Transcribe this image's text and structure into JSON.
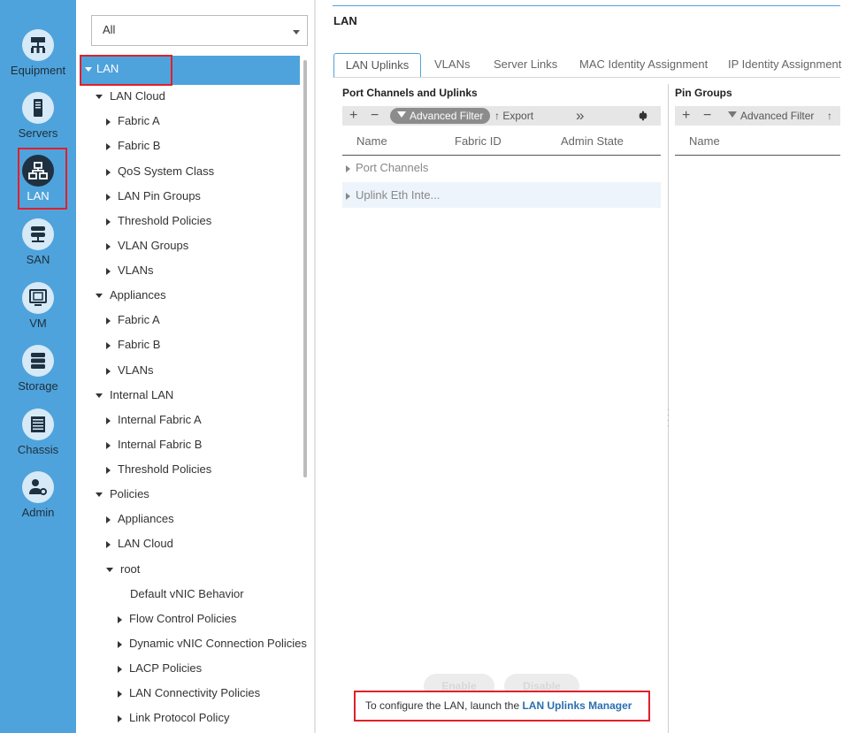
{
  "leftnav": {
    "items": [
      {
        "label": "Equipment",
        "icon": "equipment-icon"
      },
      {
        "label": "Servers",
        "icon": "servers-icon"
      },
      {
        "label": "LAN",
        "icon": "lan-icon"
      },
      {
        "label": "SAN",
        "icon": "san-icon"
      },
      {
        "label": "VM",
        "icon": "vm-icon"
      },
      {
        "label": "Storage",
        "icon": "storage-icon"
      },
      {
        "label": "Chassis",
        "icon": "chassis-icon"
      },
      {
        "label": "Admin",
        "icon": "admin-icon"
      }
    ],
    "active": "LAN",
    "accent": "#4fa3dc"
  },
  "tree": {
    "filter_value": "All",
    "rows": [
      "LAN",
      "LAN Cloud",
      "Fabric A",
      "Fabric B",
      "QoS System Class",
      "LAN Pin Groups",
      "Threshold Policies",
      "VLAN Groups",
      "VLANs",
      "Appliances",
      "Fabric A",
      "Fabric B",
      "VLANs",
      "Internal LAN",
      "Internal Fabric A",
      "Internal Fabric B",
      "Threshold Policies",
      "Policies",
      "Appliances",
      "LAN Cloud",
      "root",
      "Default vNIC Behavior",
      "Flow Control Policies",
      "Dynamic vNIC Connection Policies",
      "LACP Policies",
      "LAN Connectivity Policies",
      "Link Protocol Policy"
    ]
  },
  "main": {
    "title": "LAN",
    "tabs": [
      "LAN Uplinks",
      "VLANs",
      "Server Links",
      "MAC Identity Assignment",
      "IP Identity Assignment"
    ],
    "left_section": {
      "title": "Port Channels and Uplinks",
      "toolbar": {
        "add": "+",
        "remove": "−",
        "filter": "Advanced Filter",
        "export": "Export",
        "more": "»"
      },
      "columns": [
        "Name",
        "Fabric ID",
        "Admin State"
      ],
      "rows": [
        "Port Channels",
        "Uplink Eth Inte..."
      ]
    },
    "right_section": {
      "title": "Pin Groups",
      "toolbar": {
        "add": "+",
        "remove": "−",
        "filter": "Advanced Filter"
      },
      "columns": [
        "Name"
      ]
    },
    "buttons": {
      "enable": "Enable",
      "disable": "Disable"
    },
    "message": {
      "prefix": "To configure the LAN, launch the ",
      "link": "LAN Uplinks Manager"
    }
  },
  "colors": {
    "highlight": "#e0202a",
    "link": "#2a6fb0"
  }
}
